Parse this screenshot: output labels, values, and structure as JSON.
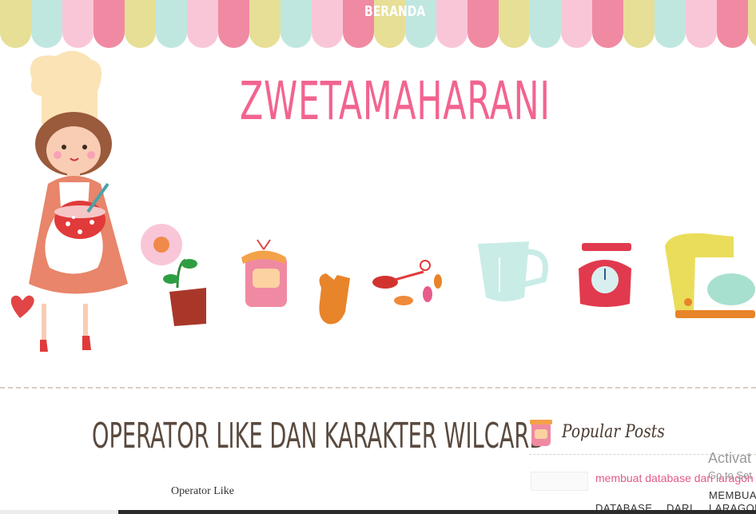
{
  "nav": {
    "home_label": "BERANDA"
  },
  "site": {
    "title": "ZWETAMAHARANI"
  },
  "post": {
    "title": "OPERATOR LIKE DAN KARAKTER WILCARD",
    "first_heading": "Operator Like"
  },
  "sidebar": {
    "popular_title": "Popular Posts",
    "popular_link": "membuat database dari laragon",
    "popular_text_words": [
      "MEMBUAT",
      "DATABASE",
      "DARI",
      "LARAGON"
    ]
  },
  "os_watermark": {
    "title": "Activat",
    "subtitle": "Go to Set"
  },
  "colors": {
    "stripe_mint": "#bfe7e0",
    "stripe_pink": "#f9c6d8",
    "stripe_rose": "#f08aa2",
    "stripe_yellow": "#e6df95",
    "title_pink": "#f2648f",
    "text_brown": "#5a4a3f"
  }
}
